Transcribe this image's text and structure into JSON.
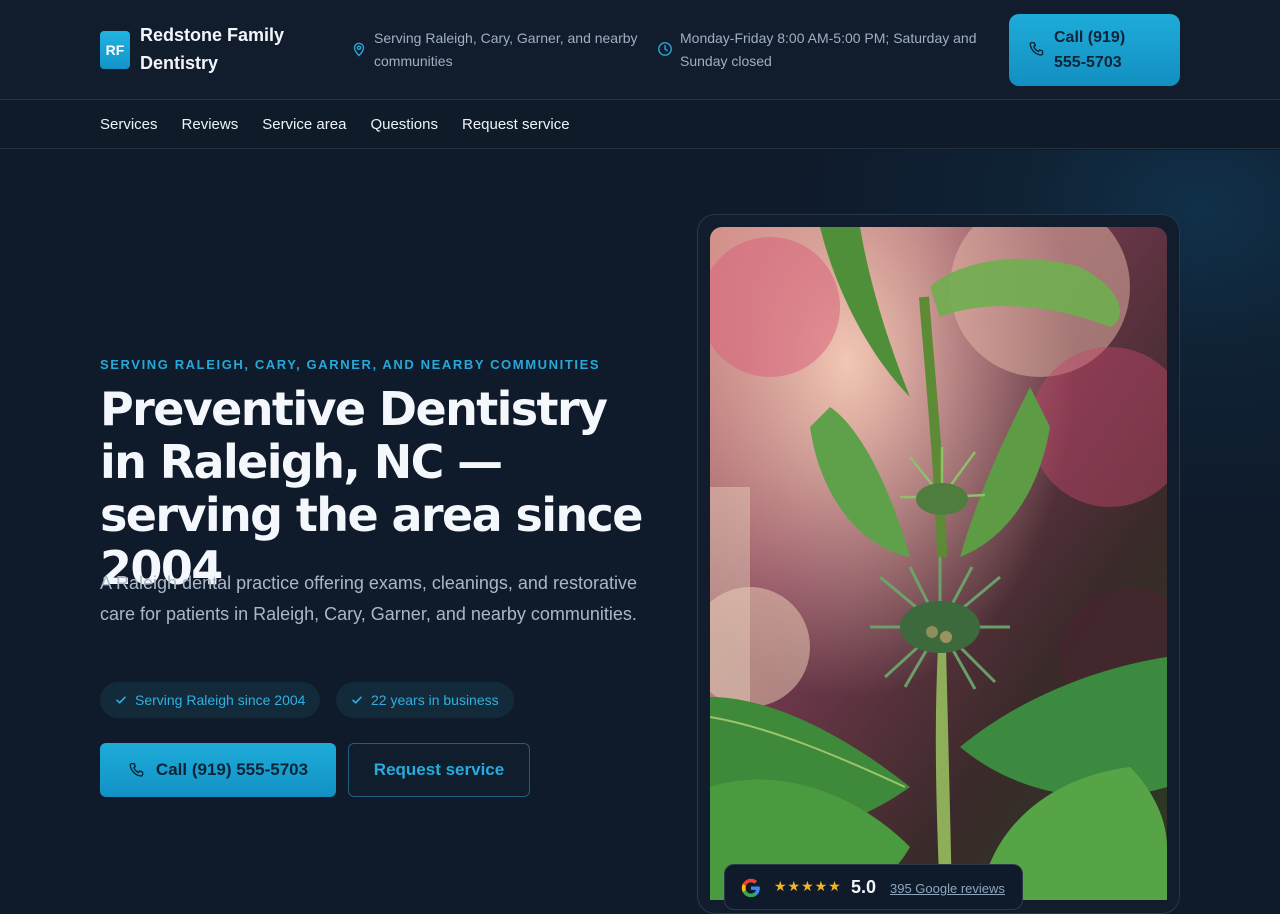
{
  "header": {
    "logo_text": "RF",
    "brand_name": "Redstone Family Dentistry",
    "service_area": "Serving Raleigh, Cary, Garner, and nearby communities",
    "hours": "Monday-Friday 8:00 AM-5:00 PM; Saturday and Sunday closed",
    "call_label": "Call (919) 555-5703",
    "icons": [
      "map-pin-icon",
      "clock-icon",
      "phone-icon"
    ]
  },
  "nav": {
    "items": [
      "Services",
      "Reviews",
      "Service area",
      "Questions",
      "Request service"
    ]
  },
  "hero": {
    "eyebrow": "SERVING RALEIGH, CARY, GARNER, AND NEARBY COMMUNITIES",
    "title": "Preventive Dentistry in Raleigh, NC — serving the area since 2004",
    "description": "A Raleigh dental practice offering exams, cleanings, and restorative care for patients in Raleigh, Cary, Garner, and nearby communities.",
    "badges": [
      "Serving Raleigh since 2004",
      "22 years in business"
    ],
    "call_button": "Call (919) 555-5703",
    "request_button": "Request service"
  },
  "reviews": {
    "stars": "★★★★★",
    "rating": "5.0",
    "link_text": "395 Google reviews"
  },
  "colors": {
    "background": "#0f1a2a",
    "accent": "#1eacd9",
    "accent_text": "#28aadc",
    "star": "#f3b325"
  }
}
